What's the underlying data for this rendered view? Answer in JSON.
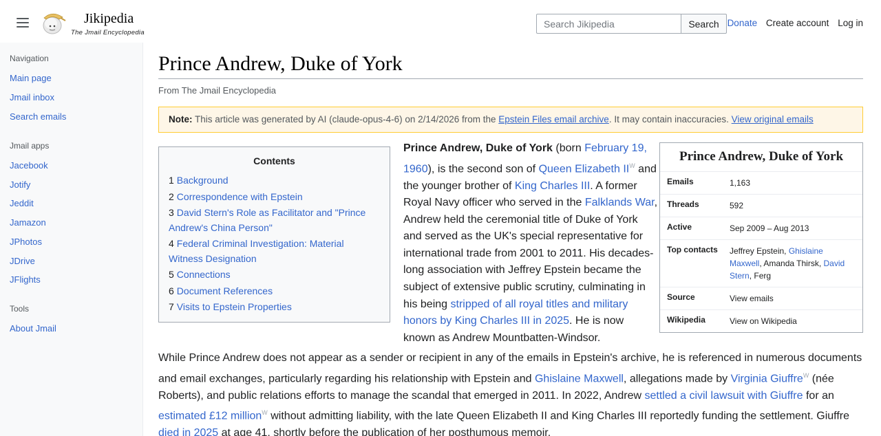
{
  "header": {
    "brand_title": "Jikipedia",
    "brand_tagline": "The Jmail Encyclopedia",
    "search_placeholder": "Search Jikipedia",
    "search_button": "Search",
    "donate": "Donate",
    "create_account": "Create account",
    "log_in": "Log in"
  },
  "sidebar": {
    "nav_heading": "Navigation",
    "nav_items": [
      "Main page",
      "Jmail inbox",
      "Search emails"
    ],
    "apps_heading": "Jmail apps",
    "app_items": [
      "Jacebook",
      "Jotify",
      "Jeddit",
      "Jamazon",
      "JPhotos",
      "JDrive",
      "JFlights"
    ],
    "tools_heading": "Tools",
    "tool_items": [
      "About Jmail"
    ]
  },
  "article": {
    "title": "Prince Andrew, Duke of York",
    "tagline": "From The Jmail Encyclopedia",
    "note": {
      "label": "Note:",
      "text": " This article was generated by AI (claude-opus-4-6) on 2/14/2026 from the ",
      "archive_link": "Epstein Files email archive",
      "text2": ". It may contain inaccuracies. ",
      "view_link": "View original emails"
    },
    "toc": {
      "title": "Contents",
      "items": [
        {
          "num": "1",
          "label": "Background"
        },
        {
          "num": "2",
          "label": "Correspondence with Epstein"
        },
        {
          "num": "3",
          "label": "David Stern's Role as Facilitator and \"Prince Andrew's China Person\""
        },
        {
          "num": "4",
          "label": "Federal Criminal Investigation: Material Witness Designation"
        },
        {
          "num": "5",
          "label": "Connections"
        },
        {
          "num": "6",
          "label": "Document References"
        },
        {
          "num": "7",
          "label": "Visits to Epstein Properties"
        }
      ]
    },
    "lead": {
      "bold_name": "Prince Andrew, Duke of York",
      "t1": " (born ",
      "l1": "February 19, 1960",
      "t2": "), is the second son of ",
      "l2": "Queen Elizabeth II",
      "t3": " and the younger brother of ",
      "l3": "King Charles III",
      "t4": ". A former Royal Navy officer who served in the ",
      "l4": "Falklands War",
      "t5": ", Andrew held the ceremonial title of Duke of York and served as the UK's special representative for international trade from 2001 to 2011. His decades-long association with Jeffrey Epstein became the subject of extensive public scrutiny, culminating in his being ",
      "l5": "stripped of all royal titles and military honors by King Charles III in 2025",
      "t6": ". He is now known as Andrew Mountbatten-Windsor."
    },
    "para2": {
      "t1": "While Prince Andrew does not appear as a sender or recipient in any of the emails in Epstein's archive, he is referenced in numerous documents and email exchanges, particularly regarding his relationship with Epstein and ",
      "l1": "Ghislaine Maxwell",
      "t2": ", allegations made by ",
      "l2": "Virginia Giuffre",
      "t3": " (née Roberts), and public relations efforts to manage the scandal that emerged in 2011. In 2022, Andrew ",
      "l3": "settled a civil lawsuit with Giuffre",
      "t4": " for an ",
      "l4": "estimated £12 million",
      "t5": " without admitting liability, with the late Queen Elizabeth II and King Charles III reportedly funding the settlement. Giuffre ",
      "l5": "died in 2025",
      "t6": " at age 41, shortly before the publication of her posthumous memoir."
    },
    "wiki_marker": "W",
    "infobox": {
      "title": "Prince Andrew, Duke of York",
      "emails_label": "Emails",
      "emails_value": "1,163",
      "threads_label": "Threads",
      "threads_value": "592",
      "active_label": "Active",
      "active_value": "Sep 2009 – Aug 2013",
      "contacts_label": "Top contacts",
      "contact_1": "Jeffrey Epstein",
      "contact_2": "Ghislaine Maxwell",
      "contact_3": "Amanda Thirsk",
      "contact_4": "David Stern",
      "contact_5": "Ferg",
      "sep": ", ",
      "source_label": "Source",
      "source_value": "View emails",
      "wikipedia_label": "Wikipedia",
      "wikipedia_value": "View on Wikipedia"
    }
  },
  "colors": {
    "link": "#3366cc",
    "note_bg": "#fef6e7",
    "note_border": "#ffcc33",
    "sidebar_bg": "#f8f9fa"
  }
}
